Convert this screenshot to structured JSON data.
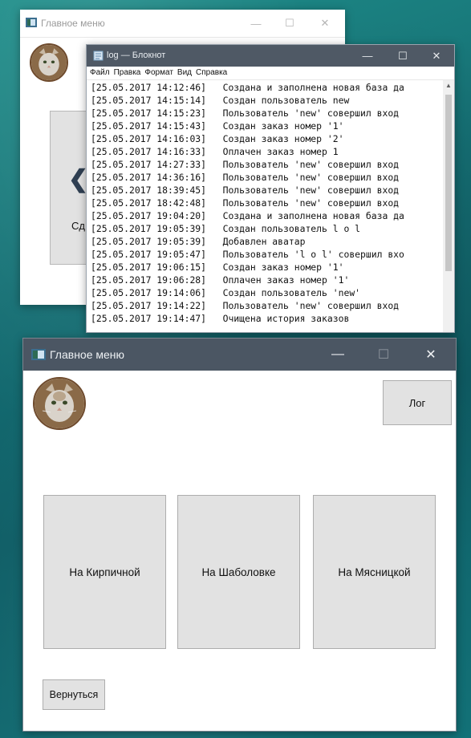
{
  "colors": {
    "desktop": "#156e73",
    "titlebar_dark": "#4b5663",
    "button_bg": "#e2e2e2",
    "button_border": "#adadad"
  },
  "back_window": {
    "title": "Главное меню",
    "partial_button_label": "Сд",
    "controls": {
      "minimize": "—",
      "maximize": "☐",
      "close": "✕"
    }
  },
  "notepad": {
    "title": "log — Блокнот",
    "controls": {
      "minimize": "—",
      "maximize": "☐",
      "close": "✕"
    },
    "menu": [
      "Файл",
      "Правка",
      "Формат",
      "Вид",
      "Справка"
    ],
    "lines": [
      "[25.05.2017 14:12:46]   Создана и заполнена новая база да",
      "[25.05.2017 14:15:14]   Создан пользователь new",
      "[25.05.2017 14:15:23]   Пользователь 'new' совершил вход",
      "[25.05.2017 14:15:43]   Создан заказ номер '1'",
      "[25.05.2017 14:16:03]   Создан заказ номер '2'",
      "[25.05.2017 14:16:33]   Оплачен заказ номер 1",
      "[25.05.2017 14:27:33]   Пользователь 'new' совершил вход",
      "[25.05.2017 14:36:16]   Пользователь 'new' совершил вход",
      "[25.05.2017 18:39:45]   Пользователь 'new' совершил вход",
      "[25.05.2017 18:42:48]   Пользователь 'new' совершил вход",
      "[25.05.2017 19:04:20]   Создана и заполнена новая база да",
      "[25.05.2017 19:05:39]   Создан пользователь l o l",
      "[25.05.2017 19:05:39]   Добавлен аватар",
      "[25.05.2017 19:05:47]   Пользователь 'l o l' совершил вхо",
      "[25.05.2017 19:06:15]   Создан заказ номер '1'",
      "[25.05.2017 19:06:28]   Оплачен заказ номер '1'",
      "[25.05.2017 19:14:06]   Создан пользователь 'new'",
      "[25.05.2017 19:14:22]   Пользователь 'new' совершил вход",
      "[25.05.2017 19:14:47]   Очищена история заказов"
    ]
  },
  "main_window": {
    "title": "Главное меню",
    "controls": {
      "minimize": "—",
      "maximize": "☐",
      "close": "✕"
    },
    "log_button": "Лог",
    "stores": [
      "На Кирпичной",
      "На Шаболовке",
      "На Мясницкой"
    ],
    "back_button": "Вернуться"
  }
}
